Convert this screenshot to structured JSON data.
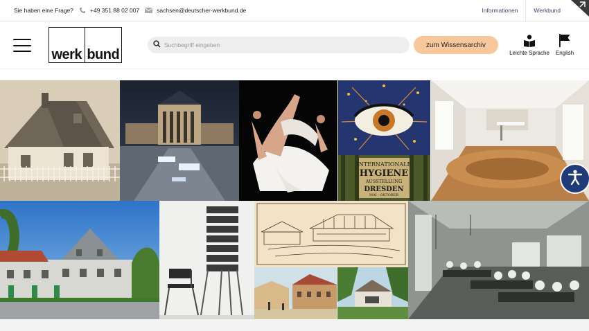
{
  "topbar": {
    "question": "Sie haben eine Frage?",
    "phone": "+49 351 88 02 007",
    "email": "sachsen@deutscher-werkbund.de",
    "links": [
      "Informationen",
      "Werkbund"
    ]
  },
  "header": {
    "logo_left": "werk",
    "logo_right": "bund",
    "search_placeholder": "Suchbegriff eingeben",
    "archive_button": "zum Wissensarchiv",
    "easy_language": "Leichte Sprache",
    "language": "English"
  },
  "poster": {
    "line1": "INTERNATIONALE",
    "line2": "HYGIENE",
    "line3": "AUSSTELLUNG",
    "line4": "DRESDEN",
    "line5": "MAI - OKTOBER",
    "line6": "1911"
  },
  "colors": {
    "accent": "#f9c79c",
    "link": "#3d4a6b",
    "a11y_button": "#1f3c78",
    "search_bg": "#eeeeee"
  }
}
